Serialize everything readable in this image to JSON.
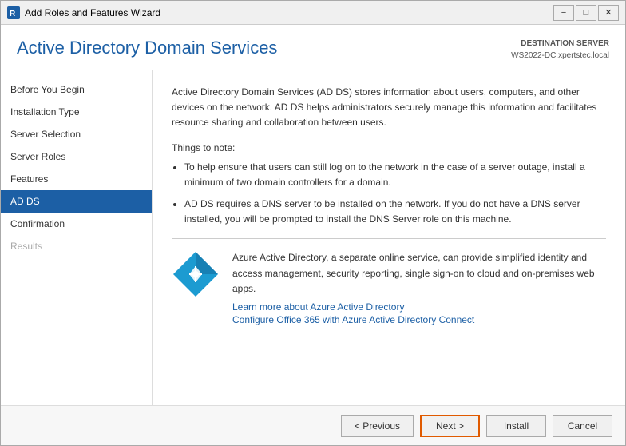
{
  "window": {
    "title": "Add Roles and Features Wizard",
    "controls": {
      "minimize": "−",
      "maximize": "□",
      "close": "✕"
    }
  },
  "header": {
    "title": "Active Directory Domain Services",
    "server_label": "DESTINATION SERVER",
    "server_name": "WS2022-DC.xpertstec.local"
  },
  "sidebar": {
    "items": [
      {
        "label": "Before You Begin",
        "state": "normal"
      },
      {
        "label": "Installation Type",
        "state": "normal"
      },
      {
        "label": "Server Selection",
        "state": "normal"
      },
      {
        "label": "Server Roles",
        "state": "normal"
      },
      {
        "label": "Features",
        "state": "normal"
      },
      {
        "label": "AD DS",
        "state": "active"
      },
      {
        "label": "Confirmation",
        "state": "normal"
      },
      {
        "label": "Results",
        "state": "disabled"
      }
    ]
  },
  "content": {
    "intro": "Active Directory Domain Services (AD DS) stores information about users, computers, and other devices on the network. AD DS helps administrators securely manage this information and facilitates resource sharing and collaboration between users.",
    "things_to_note_label": "Things to note:",
    "bullets": [
      "To help ensure that users can still log on to the network in the case of a server outage, install a minimum of two domain controllers for a domain.",
      "AD DS requires a DNS server to be installed on the network. If you do not have a DNS server installed, you will be prompted to install the DNS Server role on this machine."
    ],
    "azure": {
      "description": "Azure Active Directory, a separate online service, can provide simplified identity and access management, security reporting, single sign-on to cloud and on-premises web apps.",
      "link1": "Learn more about Azure Active Directory",
      "link2": "Configure Office 365 with Azure Active Directory Connect"
    }
  },
  "footer": {
    "previous_label": "< Previous",
    "next_label": "Next >",
    "install_label": "Install",
    "cancel_label": "Cancel"
  }
}
